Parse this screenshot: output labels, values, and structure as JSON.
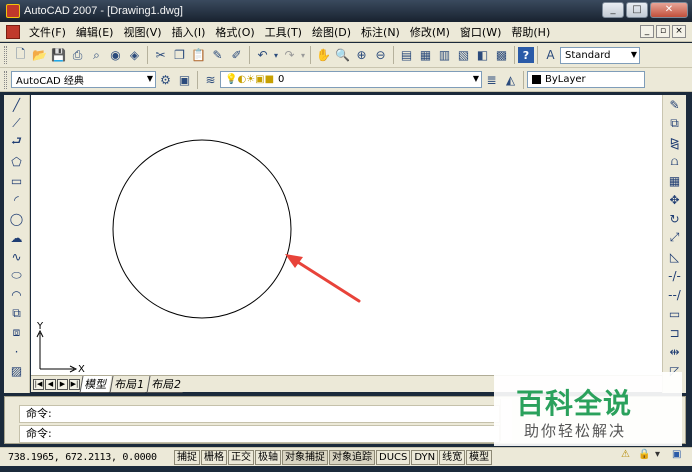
{
  "window": {
    "title": "AutoCAD 2007 - [Drawing1.dwg]",
    "controls": [
      "_",
      "□",
      "✕"
    ]
  },
  "menu": {
    "items": [
      "文件(F)",
      "编辑(E)",
      "视图(V)",
      "插入(I)",
      "格式(O)",
      "工具(T)",
      "绘图(D)",
      "标注(N)",
      "修改(M)",
      "窗口(W)",
      "帮助(H)"
    ],
    "mdi_controls": [
      "_",
      "▫",
      "×"
    ]
  },
  "toolbar1": {
    "text_style": "Standard"
  },
  "toolbar2": {
    "workspace": "AutoCAD 经典",
    "layer": "0",
    "color": "ByLayer"
  },
  "canvas": {
    "ucs_y_label": "Y",
    "ucs_x_label": "X",
    "annotation_color": "#e8433a"
  },
  "layout_tabs": [
    "模型",
    "布局1",
    "布局2"
  ],
  "command": {
    "line1": "命令:",
    "line2": "命令:"
  },
  "status": {
    "coordinates": "738.1965, 672.2113, 0.0000",
    "toggles": [
      "捕捉",
      "栅格",
      "正交",
      "极轴",
      "对象捕捉",
      "对象追踪",
      "DUCS",
      "DYN",
      "线宽",
      "模型"
    ]
  },
  "watermark": {
    "title": "百科全说",
    "subtitle": "助你轻松解决",
    "color": "#2aa15c"
  }
}
